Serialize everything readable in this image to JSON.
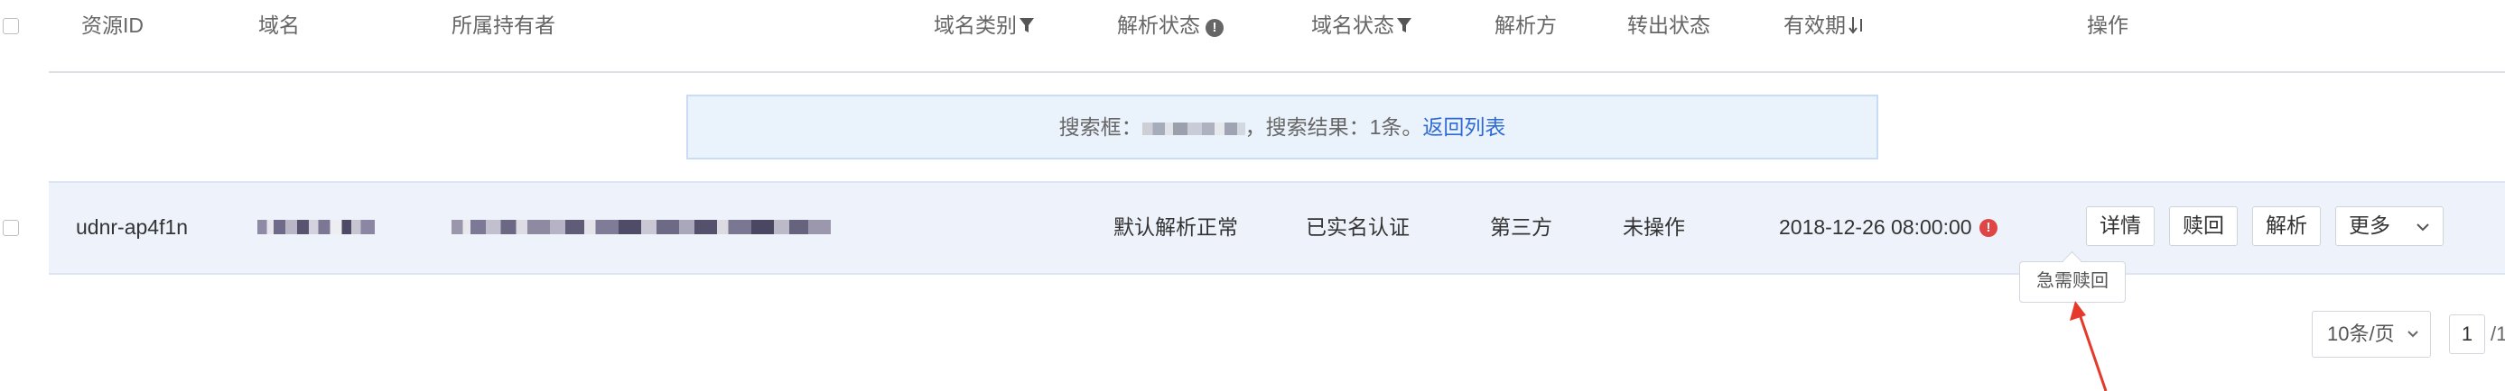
{
  "columns": [
    {
      "key": "resource_id",
      "label": "资源ID"
    },
    {
      "key": "domain",
      "label": "域名"
    },
    {
      "key": "owner",
      "label": "所属持有者"
    },
    {
      "key": "domain_type",
      "label": "域名类别",
      "icon": "filter-icon"
    },
    {
      "key": "resolve_status",
      "label": "解析状态",
      "icon": "info-icon"
    },
    {
      "key": "domain_status",
      "label": "域名状态",
      "icon": "filter-icon"
    },
    {
      "key": "resolver",
      "label": "解析方"
    },
    {
      "key": "transfer_status",
      "label": "转出状态"
    },
    {
      "key": "expiry",
      "label": "有效期",
      "icon": "sort-icon"
    },
    {
      "key": "actions",
      "label": "操作"
    }
  ],
  "search_banner": {
    "prefix": "搜索框：",
    "query_blurred": true,
    "result_text": "，搜索结果：1条。",
    "link_label": "返回列表"
  },
  "row": {
    "resource_id": "udnr-ap4f1n",
    "domain_blurred": true,
    "owner_blurred": true,
    "resolve_status": "默认解析正常",
    "domain_status": "已实名认证",
    "resolver": "第三方",
    "transfer_status": "未操作",
    "expiry": "2018-12-26 08:00:00",
    "expiry_warning_icon": "alert-icon",
    "actions": {
      "detail": "详情",
      "redeem": "赎回",
      "resolve": "解析",
      "more": "更多"
    },
    "tooltip": "急需赎回"
  },
  "pagination": {
    "page_size": "10条/页",
    "current_page": "1",
    "total_suffix": "/1"
  },
  "colors": {
    "accent_link": "#2e6ad6",
    "row_highlight": "#eef3fb",
    "banner_bg": "#eaf2fc",
    "warning": "#e04545",
    "annotation_arrow": "#e5392b"
  }
}
